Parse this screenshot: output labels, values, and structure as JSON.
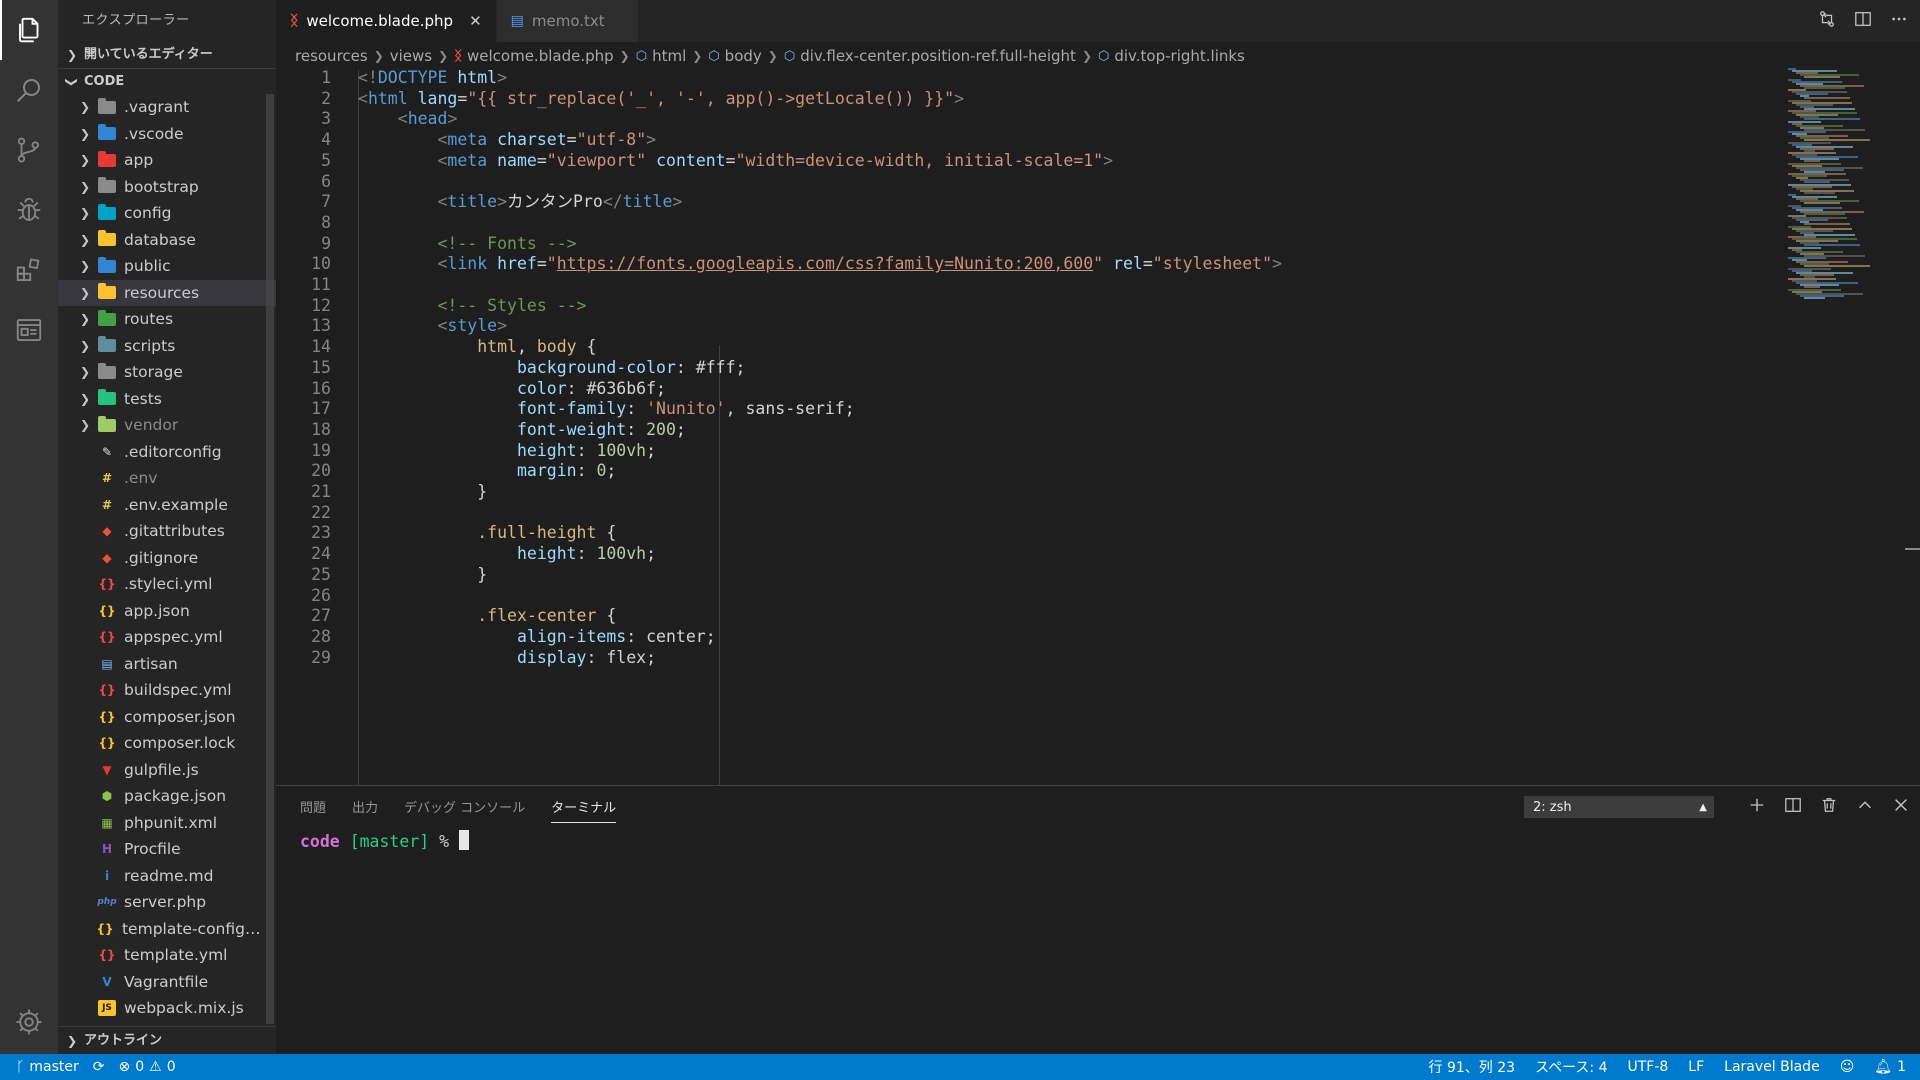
{
  "activity_bar": [
    "explorer-icon",
    "search-icon",
    "source-control-icon",
    "debug-icon",
    "extensions-icon",
    "remote-icon",
    "settings-gear-icon"
  ],
  "sidebar": {
    "title": "エクスプローラー",
    "open_editors": "開いているエディター",
    "root": "CODE",
    "outline": "アウトライン",
    "items": [
      {
        "label": ".vagrant",
        "kind": "folder",
        "color": "#8a8a8a"
      },
      {
        "label": ".vscode",
        "kind": "folder",
        "color": "#2f86d2"
      },
      {
        "label": "app",
        "kind": "folder",
        "color": "#e53935"
      },
      {
        "label": "bootstrap",
        "kind": "folder",
        "color": "#8a8a8a"
      },
      {
        "label": "config",
        "kind": "folder",
        "color": "#00a2c7"
      },
      {
        "label": "database",
        "kind": "folder",
        "color": "#f9c22e"
      },
      {
        "label": "public",
        "kind": "folder",
        "color": "#2f86d2"
      },
      {
        "label": "resources",
        "kind": "folder",
        "color": "#f9c22e"
      },
      {
        "label": "routes",
        "kind": "folder",
        "color": "#43a047"
      },
      {
        "label": "scripts",
        "kind": "folder",
        "color": "#5c8e9e"
      },
      {
        "label": "storage",
        "kind": "folder",
        "color": "#8a8a8a"
      },
      {
        "label": "tests",
        "kind": "folder",
        "color": "#26c281"
      },
      {
        "label": "vendor",
        "kind": "folder",
        "color": "#9ccc65"
      },
      {
        "label": ".editorconfig",
        "kind": "file",
        "glyph": "✎",
        "color": "#e0e0e0"
      },
      {
        "label": ".env",
        "kind": "file",
        "glyph": "#",
        "color": "#e8c54a"
      },
      {
        "label": ".env.example",
        "kind": "file",
        "glyph": "#",
        "color": "#e8c54a"
      },
      {
        "label": ".gitattributes",
        "kind": "file",
        "glyph": "◆",
        "color": "#f05133"
      },
      {
        "label": ".gitignore",
        "kind": "file",
        "glyph": "◆",
        "color": "#f05133"
      },
      {
        "label": ".styleci.yml",
        "kind": "file",
        "glyph": "{}",
        "color": "#f44747"
      },
      {
        "label": "app.json",
        "kind": "file",
        "glyph": "{}",
        "color": "#f9c22e"
      },
      {
        "label": "appspec.yml",
        "kind": "file",
        "glyph": "{}",
        "color": "#f44747"
      },
      {
        "label": "artisan",
        "kind": "file",
        "glyph": "▤",
        "color": "#75beff"
      },
      {
        "label": "buildspec.yml",
        "kind": "file",
        "glyph": "{}",
        "color": "#f44747"
      },
      {
        "label": "composer.json",
        "kind": "file",
        "glyph": "{}",
        "color": "#f9c22e"
      },
      {
        "label": "composer.lock",
        "kind": "file",
        "glyph": "{}",
        "color": "#f9c22e"
      },
      {
        "label": "gulpfile.js",
        "kind": "file",
        "glyph": "▼",
        "color": "#e53935"
      },
      {
        "label": "package.json",
        "kind": "file",
        "glyph": "⬢",
        "color": "#8bc34a"
      },
      {
        "label": "phpunit.xml",
        "kind": "file",
        "glyph": "▦",
        "color": "#8bc34a"
      },
      {
        "label": "Procfile",
        "kind": "file",
        "glyph": "H",
        "color": "#7e57c2"
      },
      {
        "label": "readme.md",
        "kind": "file",
        "glyph": "i",
        "color": "#2f86d2"
      },
      {
        "label": "server.php",
        "kind": "file",
        "glyph": "php",
        "color": "#5c7ec7"
      },
      {
        "label": "template-configura...",
        "kind": "file",
        "glyph": "{}",
        "color": "#f9c22e"
      },
      {
        "label": "template.yml",
        "kind": "file",
        "glyph": "{}",
        "color": "#f44747"
      },
      {
        "label": "Vagrantfile",
        "kind": "file",
        "glyph": "V",
        "color": "#2f86d2"
      },
      {
        "label": "webpack.mix.js",
        "kind": "file",
        "glyph": "JS",
        "color": "#f9c22e"
      }
    ]
  },
  "tabs": [
    {
      "label": "welcome.blade.php",
      "active": true
    },
    {
      "label": "memo.txt",
      "active": false
    }
  ],
  "breadcrumb": [
    "resources",
    "views",
    "welcome.blade.php",
    "html",
    "body",
    "div.flex-center.position-ref.full-height",
    "div.top-right.links"
  ],
  "editor": {
    "lines": [
      {
        "n": "1",
        "parts": [
          [
            "punct",
            "<!"
          ],
          [
            "tag",
            "DOCTYPE"
          ],
          [
            "text",
            " "
          ],
          [
            "attr",
            "html"
          ],
          [
            "punct",
            ">"
          ]
        ]
      },
      {
        "n": "2",
        "parts": [
          [
            "punct",
            "<"
          ],
          [
            "tag",
            "html"
          ],
          [
            "text",
            " "
          ],
          [
            "attr",
            "lang"
          ],
          [
            "text",
            "="
          ],
          [
            "str",
            "\"{{ str_replace('_', '-', app()->getLocale()) }}\""
          ],
          [
            "punct",
            ">"
          ]
        ]
      },
      {
        "n": "3",
        "parts": [
          [
            "text",
            "    "
          ],
          [
            "punct",
            "<"
          ],
          [
            "tag",
            "head"
          ],
          [
            "punct",
            ">"
          ]
        ]
      },
      {
        "n": "4",
        "parts": [
          [
            "text",
            "        "
          ],
          [
            "punct",
            "<"
          ],
          [
            "tag",
            "meta"
          ],
          [
            "text",
            " "
          ],
          [
            "attr",
            "charset"
          ],
          [
            "text",
            "="
          ],
          [
            "str",
            "\"utf-8\""
          ],
          [
            "punct",
            ">"
          ]
        ]
      },
      {
        "n": "5",
        "parts": [
          [
            "text",
            "        "
          ],
          [
            "punct",
            "<"
          ],
          [
            "tag",
            "meta"
          ],
          [
            "text",
            " "
          ],
          [
            "attr",
            "name"
          ],
          [
            "text",
            "="
          ],
          [
            "str",
            "\"viewport\""
          ],
          [
            "text",
            " "
          ],
          [
            "attr",
            "content"
          ],
          [
            "text",
            "="
          ],
          [
            "str",
            "\"width=device-width, initial-scale=1\""
          ],
          [
            "punct",
            ">"
          ]
        ]
      },
      {
        "n": "6",
        "parts": []
      },
      {
        "n": "7",
        "parts": [
          [
            "text",
            "        "
          ],
          [
            "punct",
            "<"
          ],
          [
            "tag",
            "title"
          ],
          [
            "punct",
            ">"
          ],
          [
            "text",
            "カンタンPro"
          ],
          [
            "punct",
            "</"
          ],
          [
            "tag",
            "title"
          ],
          [
            "punct",
            ">"
          ]
        ]
      },
      {
        "n": "8",
        "parts": []
      },
      {
        "n": "9",
        "parts": [
          [
            "text",
            "        "
          ],
          [
            "comment",
            "<!-- Fonts -->"
          ]
        ]
      },
      {
        "n": "10",
        "parts": [
          [
            "text",
            "        "
          ],
          [
            "punct",
            "<"
          ],
          [
            "tag",
            "link"
          ],
          [
            "text",
            " "
          ],
          [
            "attr",
            "href"
          ],
          [
            "text",
            "="
          ],
          [
            "str",
            "\""
          ],
          [
            "link",
            "https://fonts.googleapis.com/css?family=Nunito:200,600"
          ],
          [
            "str",
            "\""
          ],
          [
            "text",
            " "
          ],
          [
            "attr",
            "rel"
          ],
          [
            "text",
            "="
          ],
          [
            "str",
            "\"stylesheet\""
          ],
          [
            "punct",
            ">"
          ]
        ]
      },
      {
        "n": "11",
        "parts": []
      },
      {
        "n": "12",
        "parts": [
          [
            "text",
            "        "
          ],
          [
            "comment",
            "<!-- Styles -->"
          ]
        ]
      },
      {
        "n": "13",
        "parts": [
          [
            "text",
            "        "
          ],
          [
            "punct",
            "<"
          ],
          [
            "tag",
            "style"
          ],
          [
            "punct",
            ">"
          ]
        ]
      },
      {
        "n": "14",
        "parts": [
          [
            "text",
            "            "
          ],
          [
            "sel",
            "html"
          ],
          [
            "text",
            ", "
          ],
          [
            "sel",
            "body"
          ],
          [
            "text",
            " {"
          ]
        ]
      },
      {
        "n": "15",
        "parts": [
          [
            "text",
            "                "
          ],
          [
            "prop",
            "background-color"
          ],
          [
            "text",
            ": #fff;"
          ]
        ]
      },
      {
        "n": "16",
        "parts": [
          [
            "text",
            "                "
          ],
          [
            "prop",
            "color"
          ],
          [
            "text",
            ": #636b6f;"
          ]
        ]
      },
      {
        "n": "17",
        "parts": [
          [
            "text",
            "                "
          ],
          [
            "prop",
            "font-family"
          ],
          [
            "text",
            ": "
          ],
          [
            "str",
            "'Nunito'"
          ],
          [
            "text",
            ", sans-serif;"
          ]
        ]
      },
      {
        "n": "18",
        "parts": [
          [
            "text",
            "                "
          ],
          [
            "prop",
            "font-weight"
          ],
          [
            "text",
            ": "
          ],
          [
            "num",
            "200"
          ],
          [
            "text",
            ";"
          ]
        ]
      },
      {
        "n": "19",
        "parts": [
          [
            "text",
            "                "
          ],
          [
            "prop",
            "height"
          ],
          [
            "text",
            ": "
          ],
          [
            "num",
            "100vh"
          ],
          [
            "text",
            ";"
          ]
        ]
      },
      {
        "n": "20",
        "parts": [
          [
            "text",
            "                "
          ],
          [
            "prop",
            "margin"
          ],
          [
            "text",
            ": "
          ],
          [
            "num",
            "0"
          ],
          [
            "text",
            ";"
          ]
        ]
      },
      {
        "n": "21",
        "parts": [
          [
            "text",
            "            }"
          ]
        ]
      },
      {
        "n": "22",
        "parts": []
      },
      {
        "n": "23",
        "parts": [
          [
            "text",
            "            "
          ],
          [
            "sel",
            ".full-height"
          ],
          [
            "text",
            " {"
          ]
        ]
      },
      {
        "n": "24",
        "parts": [
          [
            "text",
            "                "
          ],
          [
            "prop",
            "height"
          ],
          [
            "text",
            ": "
          ],
          [
            "num",
            "100vh"
          ],
          [
            "text",
            ";"
          ]
        ]
      },
      {
        "n": "25",
        "parts": [
          [
            "text",
            "            }"
          ]
        ]
      },
      {
        "n": "26",
        "parts": []
      },
      {
        "n": "27",
        "parts": [
          [
            "text",
            "            "
          ],
          [
            "sel",
            ".flex-center"
          ],
          [
            "text",
            " {"
          ]
        ]
      },
      {
        "n": "28",
        "parts": [
          [
            "text",
            "                "
          ],
          [
            "prop",
            "align-items"
          ],
          [
            "text",
            ": center;"
          ]
        ]
      },
      {
        "n": "29",
        "parts": [
          [
            "text",
            "                "
          ],
          [
            "prop",
            "display"
          ],
          [
            "text",
            ": flex;"
          ]
        ]
      }
    ]
  },
  "panel": {
    "tabs": [
      {
        "label": "問題",
        "active": false
      },
      {
        "label": "出力",
        "active": false
      },
      {
        "label": "デバッグ コンソール",
        "active": false
      },
      {
        "label": "ターミナル",
        "active": true
      }
    ],
    "terminal_select": "2: zsh",
    "terminal": {
      "dir": "code",
      "branch": "[master]",
      "prompt": "%"
    }
  },
  "statusbar": {
    "branch": "master",
    "errors": "0",
    "warnings": "0",
    "position": "行 91、列 23",
    "spaces": "スペース: 4",
    "encoding": "UTF-8",
    "eol": "LF",
    "language": "Laravel Blade",
    "notifications": "1"
  }
}
